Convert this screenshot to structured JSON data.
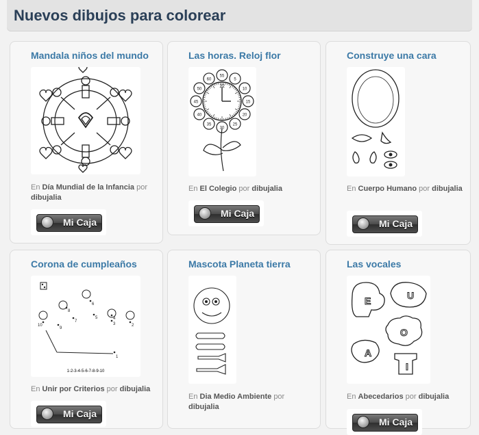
{
  "header": {
    "title": "Nuevos dibujos para colorear"
  },
  "labels": {
    "en": "En",
    "por": "por",
    "button": "Mi Caja"
  },
  "cards": [
    {
      "title": "Mandala niños del mundo",
      "category": "Día Mundial de la Infancia",
      "author": "dibujalia"
    },
    {
      "title": "Las horas. Reloj flor",
      "category": "El Colegio",
      "author": "dibujalia"
    },
    {
      "title": "Construye una cara",
      "category": "Cuerpo Humano",
      "author": "dibujalia"
    },
    {
      "title": "Corona de cumpleaños",
      "category": "Unir por Criterios",
      "author": "dibujalia"
    },
    {
      "title": "Mascota Planeta tierra",
      "category": "Dia Medio Ambiente",
      "author": "dibujalia"
    },
    {
      "title": "Las vocales",
      "category": "Abecedarios",
      "author": "dibujalia"
    }
  ],
  "thumbs": {
    "clock_numbers": [
      "55",
      "60",
      "5",
      "50",
      "10",
      "45",
      "15",
      "40",
      "20",
      "35",
      "30",
      "25"
    ],
    "clock_center": "12",
    "dots": [
      "1",
      "2",
      "3",
      "4",
      "5",
      "6",
      "7",
      "8",
      "9",
      "10"
    ],
    "dots_caption": "1-2-3-4-5-6-7-8-9-10",
    "vowels": [
      "A",
      "E",
      "I",
      "O",
      "U"
    ]
  },
  "colors": {
    "title": "#3b79a6",
    "header_text": "#2a3f57"
  }
}
